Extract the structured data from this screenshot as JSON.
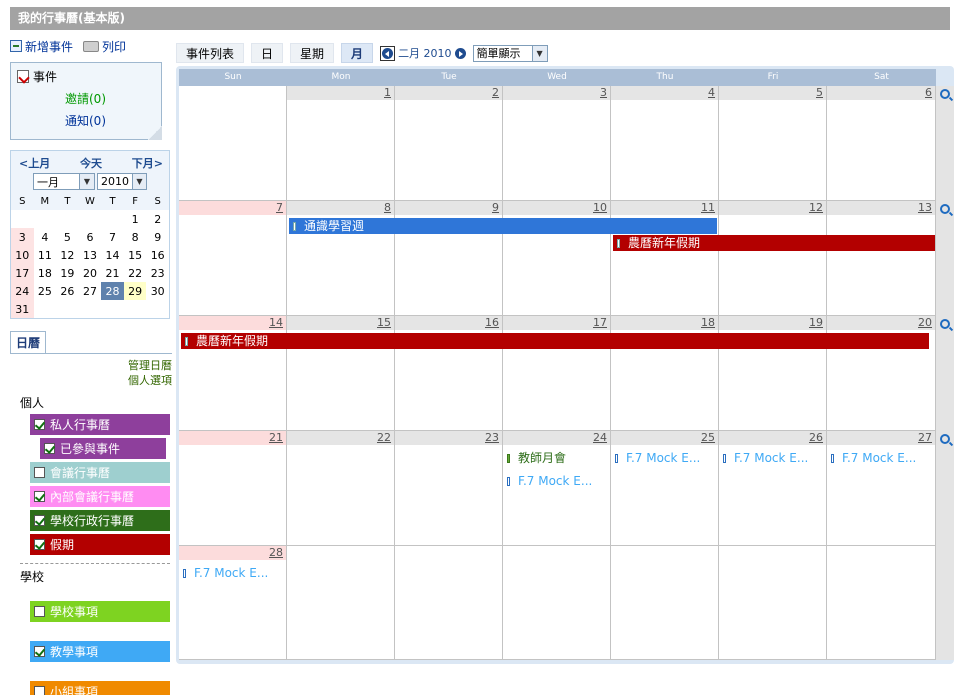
{
  "page_title": "我的行事曆(基本版)",
  "toolbar": {
    "new_event": "新增事件",
    "print": "列印"
  },
  "events_box": {
    "title": "事件",
    "invite": "邀請(0)",
    "notify": "通知(0)"
  },
  "mini_calendar": {
    "prev": "<上月",
    "today": "今天",
    "next": "下月>",
    "month_value": "一月",
    "year_value": "2010",
    "weekday_letters": [
      "S",
      "M",
      "T",
      "W",
      "T",
      "F",
      "S"
    ],
    "weeks": [
      [
        "",
        "",
        "",
        "",
        "",
        "1",
        "2"
      ],
      [
        "3",
        "4",
        "5",
        "6",
        "7",
        "8",
        "9"
      ],
      [
        "10",
        "11",
        "12",
        "13",
        "14",
        "15",
        "16"
      ],
      [
        "17",
        "18",
        "19",
        "20",
        "21",
        "22",
        "23"
      ],
      [
        "24",
        "25",
        "26",
        "27",
        "28",
        "29",
        "30"
      ],
      [
        "31",
        "",
        "",
        "",
        "",
        "",
        ""
      ]
    ]
  },
  "calendar_panel": {
    "tab": "日曆",
    "manage": "管理日曆",
    "personal_options": "個人選項",
    "group_personal": "個人",
    "group_school": "學校",
    "personal": [
      {
        "label": "私人行事曆",
        "color": "#8e3f9c",
        "checked": true
      },
      {
        "label": "已參與事件",
        "color": "#8e3f9c",
        "checked": true
      },
      {
        "label": "會議行事曆",
        "color": "#9ecfcf",
        "checked": false
      },
      {
        "label": "內部會議行事曆",
        "color": "#ff8cf2",
        "checked": true
      },
      {
        "label": "學校行政行事曆",
        "color": "#2e6e1a",
        "checked": true
      },
      {
        "label": "假期",
        "color": "#b30000",
        "checked": true
      }
    ],
    "school": [
      {
        "label": "學校事項",
        "color": "#7ed321",
        "checked": false
      },
      {
        "label": "教學事項",
        "color": "#3fa9f5",
        "checked": true
      },
      {
        "label": "小組事項",
        "color": "#f08a00",
        "checked": false
      }
    ]
  },
  "view_tabs": {
    "list": "事件列表",
    "day": "日",
    "week": "星期",
    "month": "月"
  },
  "month_nav": {
    "label": "二月 2010",
    "display_mode": "簡單顯示"
  },
  "weekdays": [
    "Sun",
    "Mon",
    "Tue",
    "Wed",
    "Thu",
    "Fri",
    "Sat"
  ],
  "weeks": [
    [
      "",
      "1",
      "2",
      "3",
      "4",
      "5",
      "6"
    ],
    [
      "7",
      "8",
      "9",
      "10",
      "11",
      "12",
      "13"
    ],
    [
      "14",
      "15",
      "16",
      "17",
      "18",
      "19",
      "20"
    ],
    [
      "21",
      "22",
      "23",
      "24",
      "25",
      "26",
      "27"
    ],
    [
      "28",
      "",
      "",
      "",
      "",
      "",
      ""
    ]
  ],
  "events": {
    "study_week": "通識學習週",
    "cny1": "農曆新年假期",
    "cny2": "農曆新年假期",
    "teacher_meeting": "教師月會",
    "mock_wed": "F.7 Mock E...",
    "mock_thu": "F.7 Mock E...",
    "mock_fri": "F.7 Mock E...",
    "mock_sat": "F.7 Mock E...",
    "mock_sun": "F.7 Mock E..."
  },
  "colors": {
    "blue_event": "#2f76d8",
    "red_event": "#b30000",
    "green_text": "#2e6e1a",
    "mock_text": "#3fa9f5"
  }
}
